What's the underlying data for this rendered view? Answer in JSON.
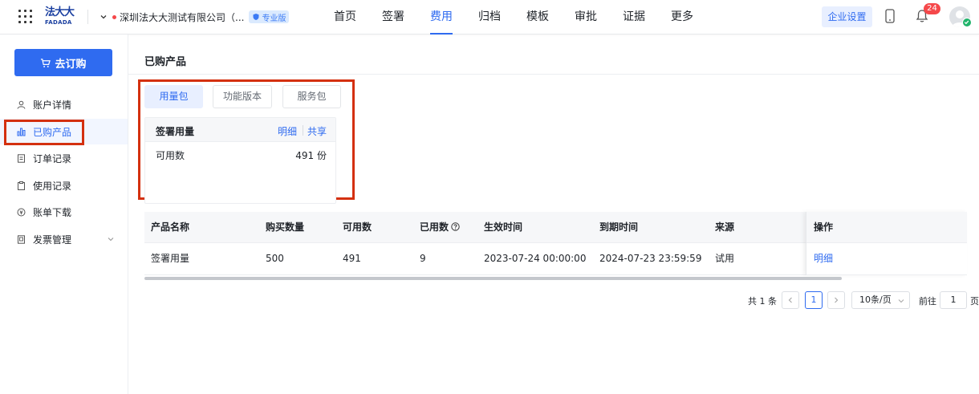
{
  "header": {
    "logo_cn": "法大大",
    "logo_en": "FADADA",
    "company_name": "深圳法大大测试有限公司（...",
    "edition_badge": "专业版",
    "nav": [
      {
        "label": "首页",
        "active": false
      },
      {
        "label": "签署",
        "active": false
      },
      {
        "label": "费用",
        "active": true
      },
      {
        "label": "归档",
        "active": false
      },
      {
        "label": "模板",
        "active": false
      },
      {
        "label": "审批",
        "active": false
      },
      {
        "label": "证据",
        "active": false
      },
      {
        "label": "更多",
        "active": false
      }
    ],
    "enterprise_settings": "企业设置",
    "notification_count": "24"
  },
  "sidebar": {
    "buy_button": "去订购",
    "items": [
      {
        "label": "账户详情",
        "icon": "user-icon",
        "active": false
      },
      {
        "label": "已购产品",
        "icon": "bar-chart-icon",
        "active": true
      },
      {
        "label": "订单记录",
        "icon": "document-icon",
        "active": false
      },
      {
        "label": "使用记录",
        "icon": "clipboard-icon",
        "active": false
      },
      {
        "label": "账单下载",
        "icon": "bill-icon",
        "active": false
      },
      {
        "label": "发票管理",
        "icon": "invoice-icon",
        "active": false,
        "expandable": true
      }
    ]
  },
  "main": {
    "title": "已购产品",
    "tabs": [
      {
        "label": "用量包",
        "active": true
      },
      {
        "label": "功能版本",
        "active": false
      },
      {
        "label": "服务包",
        "active": false
      }
    ],
    "card": {
      "title": "签署用量",
      "link_detail": "明细",
      "link_share": "共享",
      "row_label": "可用数",
      "row_value": "491 份"
    },
    "table": {
      "columns": [
        "产品名称",
        "购买数量",
        "可用数",
        "已用数",
        "生效时间",
        "到期时间",
        "来源",
        "操作"
      ],
      "rows": [
        {
          "name": "签署用量",
          "purchased": "500",
          "available": "491",
          "used": "9",
          "start": "2023-07-24 00:00:00",
          "end": "2024-07-23 23:59:59",
          "source": "试用",
          "action": "明细"
        }
      ]
    },
    "pagination": {
      "total": "共 1 条",
      "current_page": "1",
      "page_size": "10条/页",
      "goto_label": "前往",
      "goto_value": "1",
      "page_unit": "页"
    }
  },
  "colors": {
    "primary": "#2f6bf0",
    "highlight_box": "#d4300f",
    "badge_red": "#f5484a"
  }
}
